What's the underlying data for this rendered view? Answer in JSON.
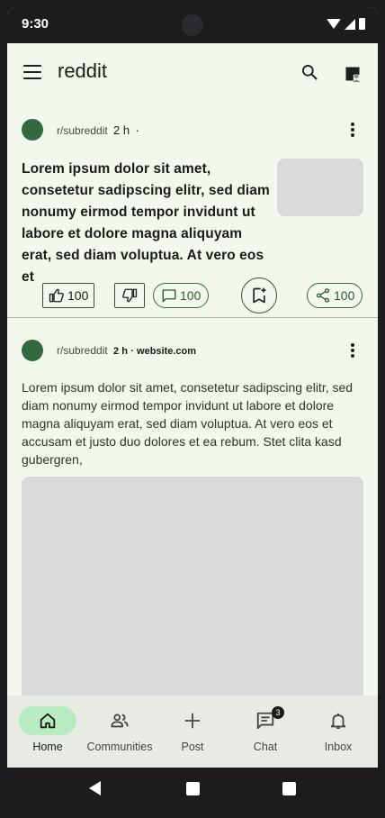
{
  "status_bar": {
    "time": "9:30"
  },
  "app_bar": {
    "title": "reddit"
  },
  "posts": [
    {
      "subreddit": "r/subreddit",
      "age": "2 h",
      "separator": "·",
      "body": "Lorem ipsum dolor sit amet, consetetur sadipscing elitr, sed diam nonumy eirmod tempor invidunt ut labore et dolore magna aliquyam erat, sed diam voluptua. At vero eos et",
      "upvotes": "100",
      "comments": "100",
      "shares": "100"
    },
    {
      "subreddit": "r/subreddit",
      "age": "2 h",
      "site": "· website.com",
      "body": "Lorem ipsum dolor sit amet, consetetur sadipscing elitr, sed diam nonumy eirmod tempor invidunt ut labore et dolore magna aliquyam erat, sed diam voluptua. At vero eos et accusam et justo duo dolores et ea rebum. Stet clita kasd gubergren,"
    }
  ],
  "bottom_nav": [
    {
      "label": "Home",
      "icon": "home-icon",
      "active": true
    },
    {
      "label": "Communities",
      "icon": "communities-icon"
    },
    {
      "label": "Post",
      "icon": "plus-icon"
    },
    {
      "label": "Chat",
      "icon": "chat-icon",
      "badge": "3"
    },
    {
      "label": "Inbox",
      "icon": "bell-icon"
    }
  ],
  "colors": {
    "background": "#f3f8ef",
    "accent": "#33693f",
    "active_pill": "#b7ecc0",
    "nav_bar": "#e7ebe3",
    "placeholder": "#d9d9d9"
  }
}
